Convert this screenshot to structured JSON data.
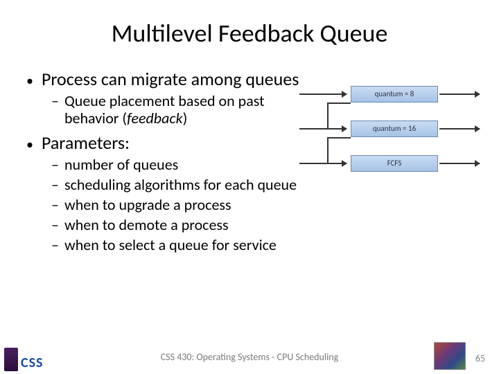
{
  "title": "Multilevel Feedback Queue",
  "bullets": {
    "migrate": "Process can migrate among queues",
    "migrate_sub_pre": "Queue placement based on past behavior (",
    "migrate_sub_em": "feedback",
    "migrate_sub_post": ")",
    "parameters": "Parameters:",
    "params": [
      "number of queues",
      "scheduling algorithms for each queue",
      "when to upgrade a process",
      "when to demote a process",
      "when to select a queue for service"
    ]
  },
  "diagram": {
    "q1": "quantum = 8",
    "q2": "quantum = 16",
    "q3": "FCFS"
  },
  "footer": "CSS 430: Operating Systems - CPU Scheduling",
  "page": "65",
  "logo_css": "CSS"
}
